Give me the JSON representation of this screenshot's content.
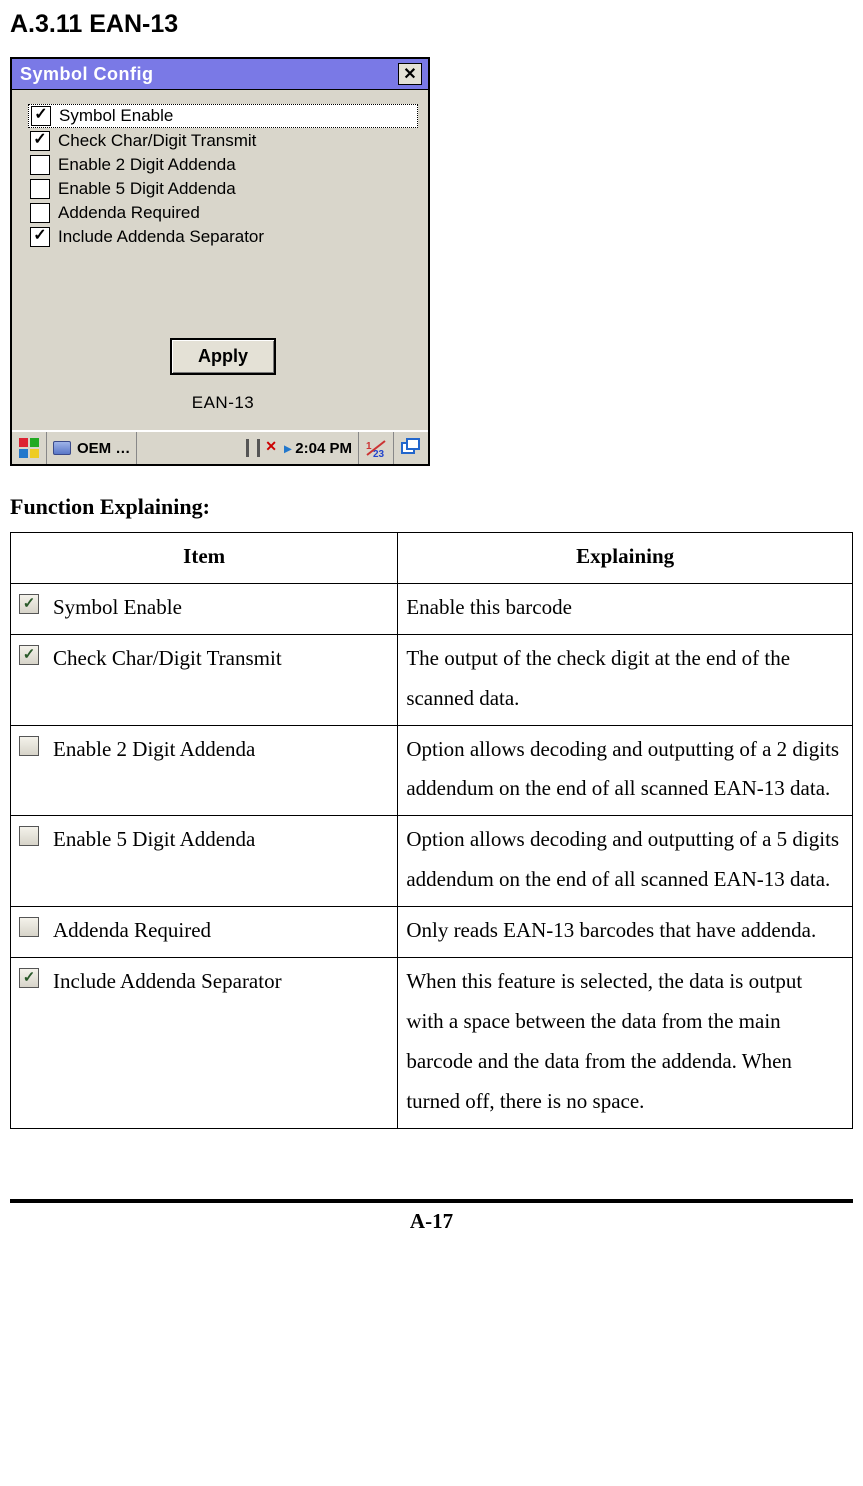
{
  "heading": "A.3.11 EAN-13",
  "window": {
    "title": "Symbol Config",
    "options": [
      {
        "label": "Symbol Enable",
        "checked": true,
        "selected": true
      },
      {
        "label": "Check Char/Digit Transmit",
        "checked": true,
        "selected": false
      },
      {
        "label": "Enable 2 Digit Addenda",
        "checked": false,
        "selected": false
      },
      {
        "label": "Enable 5 Digit Addenda",
        "checked": false,
        "selected": false
      },
      {
        "label": "Addenda Required",
        "checked": false,
        "selected": false
      },
      {
        "label": "Include Addenda Separator",
        "checked": true,
        "selected": false
      }
    ],
    "apply_label": "Apply",
    "caption": "EAN-13",
    "taskbar": {
      "oem_label": "OEM …",
      "time": "2:04 PM"
    }
  },
  "function_heading": "Function Explaining:",
  "table": {
    "headers": {
      "item": "Item",
      "explaining": "Explaining"
    },
    "rows": [
      {
        "checked": true,
        "item": "Symbol Enable",
        "explain": "Enable this barcode"
      },
      {
        "checked": true,
        "item": "Check Char/Digit Transmit",
        "explain": "The output of the check digit at the end of the scanned data."
      },
      {
        "checked": false,
        "item": "Enable 2 Digit Addenda",
        "explain": "Option allows decoding and outputting of a 2 digits addendum on the end of all scanned EAN-13 data."
      },
      {
        "checked": false,
        "item": "Enable 5 Digit Addenda",
        "explain": "Option allows decoding and outputting of a 5 digits addendum on the end of all scanned EAN-13 data."
      },
      {
        "checked": false,
        "item": "Addenda Required",
        "explain": "Only reads EAN-13 barcodes that have addenda."
      },
      {
        "checked": true,
        "item": "Include Addenda Separator",
        "explain": "When this feature is selected, the data is output with a space between the data from the main barcode and the data from the addenda. When turned off, there is no space."
      }
    ]
  },
  "page_number": "A-17"
}
